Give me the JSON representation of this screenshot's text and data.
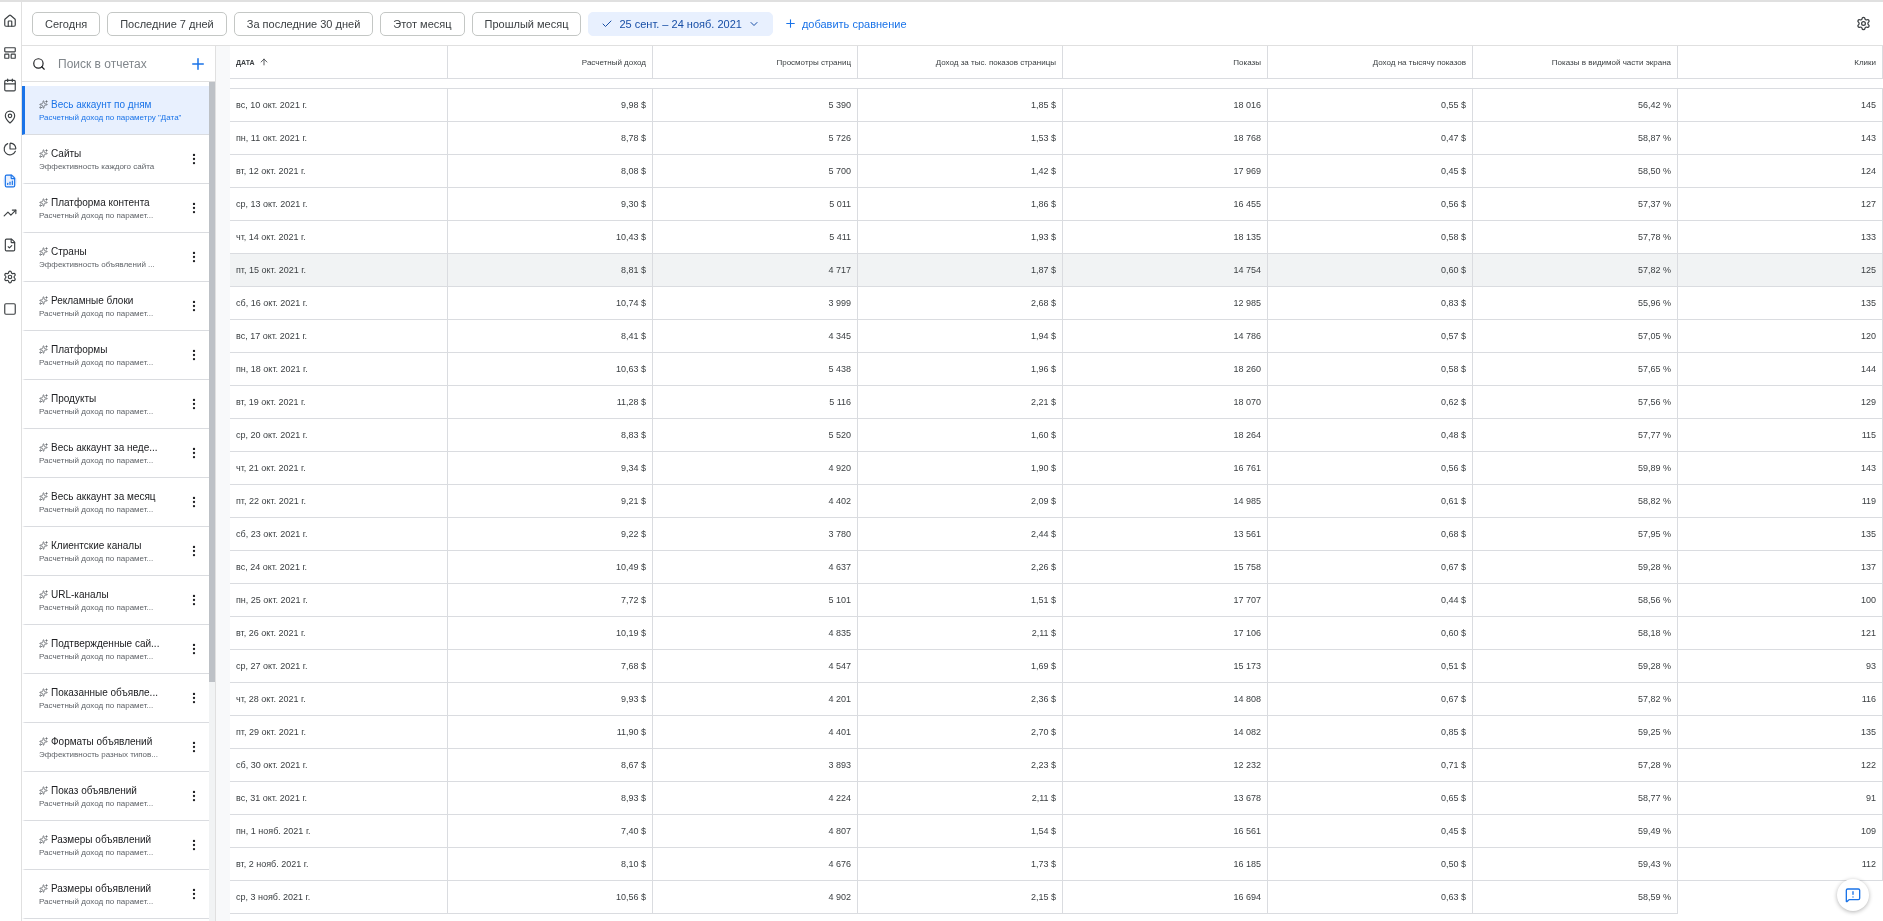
{
  "date_filters": [
    {
      "label": "Сегодня",
      "selected": false
    },
    {
      "label": "Последние 7 дней",
      "selected": false
    },
    {
      "label": "За последние 30 дней",
      "selected": false
    },
    {
      "label": "Этот месяц",
      "selected": false
    },
    {
      "label": "Прошлый месяц",
      "selected": false
    },
    {
      "label": "25 сент. – 24 нояб. 2021",
      "selected": true
    }
  ],
  "add_comparison": "добавить сравнение",
  "sidebar": {
    "search": {
      "placeholder": "Поиск в отчетах"
    },
    "items": [
      {
        "title": "Весь аккаунт по дням",
        "subtitle": "Расчетный доход по параметру \"Дата\"",
        "selected": true
      },
      {
        "title": "Сайты",
        "subtitle": "Эффективность каждого сайта",
        "selected": false
      },
      {
        "title": "Платформа контента",
        "subtitle": "Расчетный доход по парамет...",
        "selected": false
      },
      {
        "title": "Страны",
        "subtitle": "Эффективность объявлений ...",
        "selected": false
      },
      {
        "title": "Рекламные блоки",
        "subtitle": "Расчетный доход по парамет...",
        "selected": false
      },
      {
        "title": "Платформы",
        "subtitle": "Расчетный доход по парамет...",
        "selected": false
      },
      {
        "title": "Продукты",
        "subtitle": "Расчетный доход по парамет...",
        "selected": false
      },
      {
        "title": "Весь аккаунт за неде...",
        "subtitle": "Расчетный доход по парамет...",
        "selected": false
      },
      {
        "title": "Весь аккаунт за месяц",
        "subtitle": "Расчетный доход по парамет...",
        "selected": false
      },
      {
        "title": "Клиентские каналы",
        "subtitle": "Расчетный доход по парамет...",
        "selected": false
      },
      {
        "title": "URL-каналы",
        "subtitle": "Расчетный доход по парамет...",
        "selected": false
      },
      {
        "title": "Подтвержденные сай...",
        "subtitle": "Расчетный доход по парамет...",
        "selected": false
      },
      {
        "title": "Показанные объявле...",
        "subtitle": "Расчетный доход по парамет...",
        "selected": false
      },
      {
        "title": "Форматы объявлений",
        "subtitle": "Эффективность разных типов...",
        "selected": false
      },
      {
        "title": "Показ объявлений",
        "subtitle": "Расчетный доход по парамет...",
        "selected": false
      },
      {
        "title": "Размеры объявлений",
        "subtitle": "Расчетный доход по парамет...",
        "selected": false
      },
      {
        "title": "Размеры объявлений",
        "subtitle": "Расчетный доход по парамет...",
        "selected": false
      }
    ]
  },
  "table": {
    "columns": [
      "ДАТА",
      "Расчетный доход",
      "Просмотры страниц",
      "Доход за тыс. показов страницы",
      "Показы",
      "Доход на тысячу показов",
      "Показы в видимой части экрана",
      "Клики"
    ],
    "rows": [
      {
        "selected": false,
        "cells": [
          "вс, 10 окт. 2021 г.",
          "9,98 $",
          "5 390",
          "1,85 $",
          "18 016",
          "0,55 $",
          "56,42 %",
          "145"
        ]
      },
      {
        "selected": false,
        "cells": [
          "пн, 11 окт. 2021 г.",
          "8,78 $",
          "5 726",
          "1,53 $",
          "18 768",
          "0,47 $",
          "58,87 %",
          "143"
        ]
      },
      {
        "selected": false,
        "cells": [
          "вт, 12 окт. 2021 г.",
          "8,08 $",
          "5 700",
          "1,42 $",
          "17 969",
          "0,45 $",
          "58,50 %",
          "124"
        ]
      },
      {
        "selected": false,
        "cells": [
          "ср, 13 окт. 2021 г.",
          "9,30 $",
          "5 011",
          "1,86 $",
          "16 455",
          "0,56 $",
          "57,37 %",
          "127"
        ]
      },
      {
        "selected": false,
        "cells": [
          "чт, 14 окт. 2021 г.",
          "10,43 $",
          "5 411",
          "1,93 $",
          "18 135",
          "0,58 $",
          "57,78 %",
          "133"
        ]
      },
      {
        "selected": true,
        "cells": [
          "пт, 15 окт. 2021 г.",
          "8,81 $",
          "4 717",
          "1,87 $",
          "14 754",
          "0,60 $",
          "57,82 %",
          "125"
        ]
      },
      {
        "selected": false,
        "cells": [
          "сб, 16 окт. 2021 г.",
          "10,74 $",
          "3 999",
          "2,68 $",
          "12 985",
          "0,83 $",
          "55,96 %",
          "135"
        ]
      },
      {
        "selected": false,
        "cells": [
          "вс, 17 окт. 2021 г.",
          "8,41 $",
          "4 345",
          "1,94 $",
          "14 786",
          "0,57 $",
          "57,05 %",
          "120"
        ]
      },
      {
        "selected": false,
        "cells": [
          "пн, 18 окт. 2021 г.",
          "10,63 $",
          "5 438",
          "1,96 $",
          "18 260",
          "0,58 $",
          "57,65 %",
          "144"
        ]
      },
      {
        "selected": false,
        "cells": [
          "вт, 19 окт. 2021 г.",
          "11,28 $",
          "5 116",
          "2,21 $",
          "18 070",
          "0,62 $",
          "57,56 %",
          "129"
        ]
      },
      {
        "selected": false,
        "cells": [
          "ср, 20 окт. 2021 г.",
          "8,83 $",
          "5 520",
          "1,60 $",
          "18 264",
          "0,48 $",
          "57,77 %",
          "115"
        ]
      },
      {
        "selected": false,
        "cells": [
          "чт, 21 окт. 2021 г.",
          "9,34 $",
          "4 920",
          "1,90 $",
          "16 761",
          "0,56 $",
          "59,89 %",
          "143"
        ]
      },
      {
        "selected": false,
        "cells": [
          "пт, 22 окт. 2021 г.",
          "9,21 $",
          "4 402",
          "2,09 $",
          "14 985",
          "0,61 $",
          "58,82 %",
          "119"
        ]
      },
      {
        "selected": false,
        "cells": [
          "сб, 23 окт. 2021 г.",
          "9,22 $",
          "3 780",
          "2,44 $",
          "13 561",
          "0,68 $",
          "57,95 %",
          "135"
        ]
      },
      {
        "selected": false,
        "cells": [
          "вс, 24 окт. 2021 г.",
          "10,49 $",
          "4 637",
          "2,26 $",
          "15 758",
          "0,67 $",
          "59,28 %",
          "137"
        ]
      },
      {
        "selected": false,
        "cells": [
          "пн, 25 окт. 2021 г.",
          "7,72 $",
          "5 101",
          "1,51 $",
          "17 707",
          "0,44 $",
          "58,56 %",
          "100"
        ]
      },
      {
        "selected": false,
        "cells": [
          "вт, 26 окт. 2021 г.",
          "10,19 $",
          "4 835",
          "2,11 $",
          "17 106",
          "0,60 $",
          "58,18 %",
          "121"
        ]
      },
      {
        "selected": false,
        "cells": [
          "ср, 27 окт. 2021 г.",
          "7,68 $",
          "4 547",
          "1,69 $",
          "15 173",
          "0,51 $",
          "59,28 %",
          "93"
        ]
      },
      {
        "selected": false,
        "cells": [
          "чт, 28 окт. 2021 г.",
          "9,93 $",
          "4 201",
          "2,36 $",
          "14 808",
          "0,67 $",
          "57,82 %",
          "116"
        ]
      },
      {
        "selected": false,
        "cells": [
          "пт, 29 окт. 2021 г.",
          "11,90 $",
          "4 401",
          "2,70 $",
          "14 082",
          "0,85 $",
          "59,25 %",
          "135"
        ]
      },
      {
        "selected": false,
        "cells": [
          "сб, 30 окт. 2021 г.",
          "8,67 $",
          "3 893",
          "2,23 $",
          "12 232",
          "0,71 $",
          "57,28 %",
          "122"
        ]
      },
      {
        "selected": false,
        "cells": [
          "вс, 31 окт. 2021 г.",
          "8,93 $",
          "4 224",
          "2,11 $",
          "13 678",
          "0,65 $",
          "58,77 %",
          "91"
        ]
      },
      {
        "selected": false,
        "cells": [
          "пн, 1 нояб. 2021 г.",
          "7,40 $",
          "4 807",
          "1,54 $",
          "16 561",
          "0,45 $",
          "59,49 %",
          "109"
        ]
      },
      {
        "selected": false,
        "cells": [
          "вт, 2 нояб. 2021 г.",
          "8,10 $",
          "4 676",
          "1,73 $",
          "16 185",
          "0,50 $",
          "59,43 %",
          "112"
        ]
      },
      {
        "selected": false,
        "cells": [
          "ср, 3 нояб. 2021 г.",
          "10,56 $",
          "4 902",
          "2,15 $",
          "16 694",
          "0,63 $",
          "58,59 %"
        ]
      }
    ]
  }
}
